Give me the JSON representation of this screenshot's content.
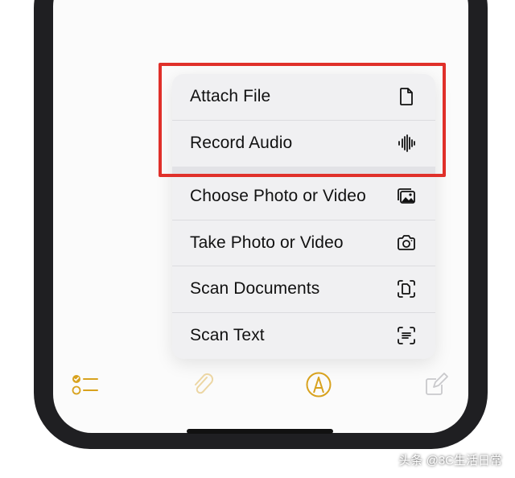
{
  "menu": {
    "items": [
      {
        "label": "Attach File",
        "icon": "document-icon"
      },
      {
        "label": "Record Audio",
        "icon": "waveform-icon"
      },
      {
        "label": "Choose Photo or Video",
        "icon": "photo-library-icon"
      },
      {
        "label": "Take Photo or Video",
        "icon": "camera-icon"
      },
      {
        "label": "Scan Documents",
        "icon": "doc-scan-icon"
      },
      {
        "label": "Scan Text",
        "icon": "text-scan-icon"
      }
    ]
  },
  "toolbar": {
    "icons": [
      "checklist-icon",
      "paperclip-icon",
      "markup-icon",
      "compose-icon"
    ]
  },
  "colors": {
    "accent": "#d8a21e",
    "highlight": "#e0302a"
  },
  "watermark": {
    "text": "头条 @3C生活日常"
  }
}
